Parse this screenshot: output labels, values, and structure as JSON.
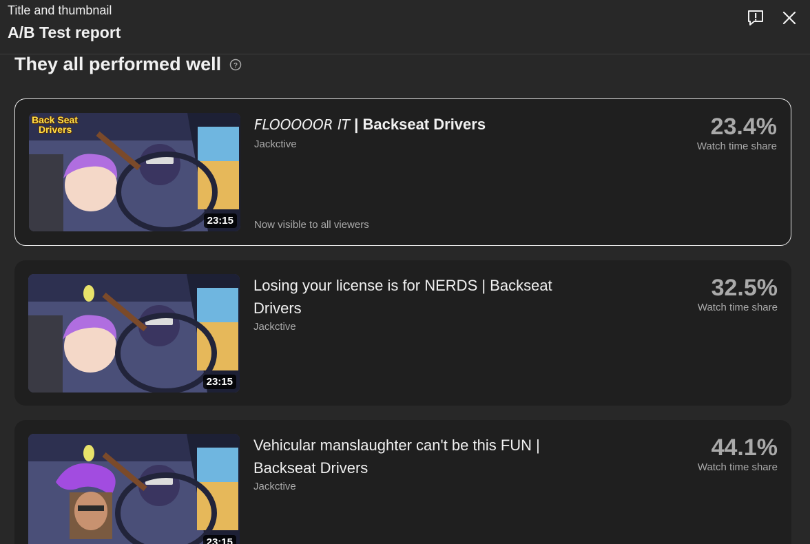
{
  "header": {
    "subtitle": "Title and thumbnail",
    "title": "A/B Test report"
  },
  "icons": {
    "feedback": "feedback-icon",
    "close": "close-icon",
    "help": "help-circle-icon"
  },
  "section": {
    "title": "They all performed well"
  },
  "variants": [
    {
      "title_prefix": "FLOOOOOR IT",
      "title_suffix": " | Backseat Drivers",
      "channel": "Jackctive",
      "duration": "23:15",
      "note": "Now visible to all viewers",
      "share": "23.4%",
      "share_label": "Watch time share"
    },
    {
      "title": "Losing your license is for NERDS | Backseat Drivers",
      "channel": "Jackctive",
      "duration": "23:15",
      "share": "32.5%",
      "share_label": "Watch time share"
    },
    {
      "title": "Vehicular manslaughter can't be this FUN | Backseat Drivers",
      "channel": "Jackctive",
      "duration": "23:15",
      "share": "44.1%",
      "share_label": "Watch time share"
    }
  ],
  "thumb_logo": {
    "line1": "Back Seat",
    "line2": "Drivers"
  }
}
